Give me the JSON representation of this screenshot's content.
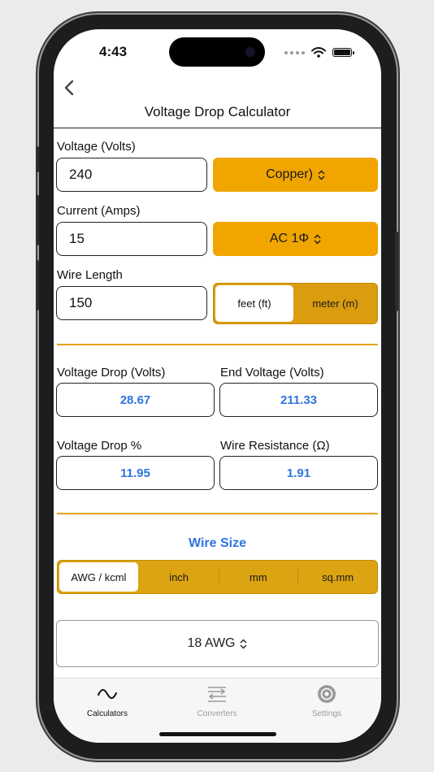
{
  "status_bar": {
    "time": "4:43"
  },
  "nav": {
    "title": "Voltage Drop Calculator"
  },
  "inputs": {
    "voltage_label": "Voltage (Volts)",
    "voltage_value": "240",
    "material_picker": "Copper)",
    "current_label": "Current (Amps)",
    "current_value": "15",
    "phase_picker": "AC 1Φ",
    "length_label": "Wire Length",
    "length_value": "150",
    "length_units": [
      {
        "label": "feet (ft)",
        "selected": true
      },
      {
        "label": "meter (m)",
        "selected": false
      }
    ]
  },
  "results": {
    "voltage_drop_label": "Voltage Drop (Volts)",
    "voltage_drop_value": "28.67",
    "end_voltage_label": "End Voltage (Volts)",
    "end_voltage_value": "211.33",
    "voltage_drop_pct_label": "Voltage Drop %",
    "voltage_drop_pct_value": "11.95",
    "wire_resistance_label": "Wire Resistance (Ω)",
    "wire_resistance_value": "1.91"
  },
  "wire_size": {
    "title": "Wire Size",
    "units": [
      {
        "label": "AWG / kcml",
        "selected": true
      },
      {
        "label": "inch",
        "selected": false
      },
      {
        "label": "mm",
        "selected": false
      },
      {
        "label": "sq.mm",
        "selected": false
      }
    ],
    "selected_size": "18 AWG"
  },
  "tab_bar": {
    "items": [
      {
        "label": "Calculators",
        "icon": "sine-wave-icon",
        "active": true
      },
      {
        "label": "Converters",
        "icon": "swap-arrows-icon",
        "active": false
      },
      {
        "label": "Settings",
        "icon": "gear-icon",
        "active": false
      }
    ]
  },
  "colors": {
    "accent": "#f0a500",
    "accent_dark": "#dc9c10",
    "result_text": "#2f74e0",
    "tab_inactive": "#9a9a9a"
  }
}
